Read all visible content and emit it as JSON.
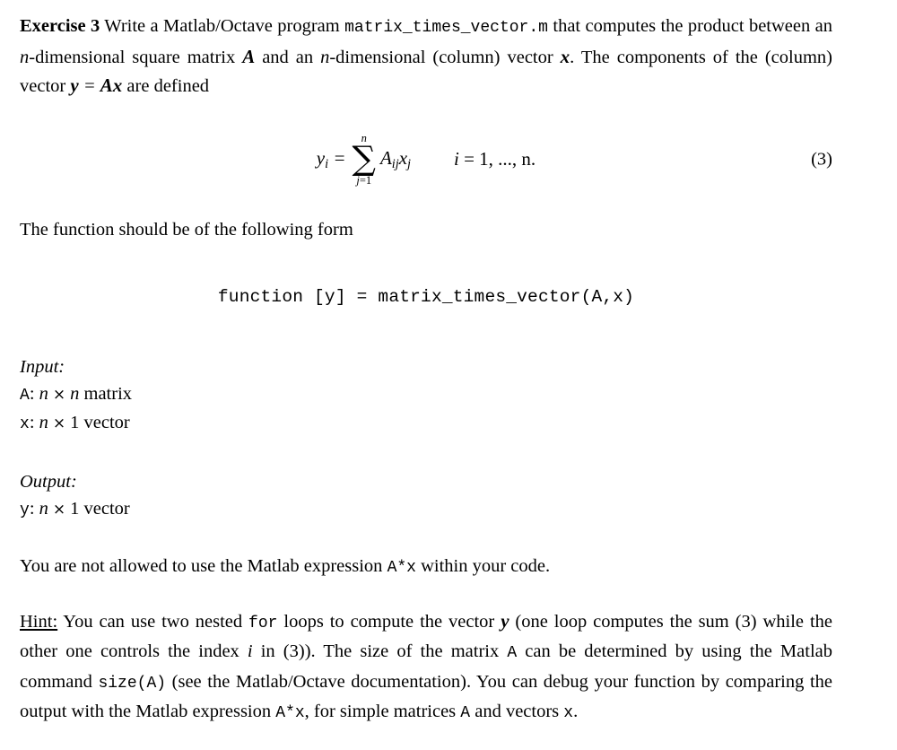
{
  "document": {
    "exercise_label": "Exercise 3",
    "intro": {
      "before_code": " Write a Matlab/Octave program ",
      "code_filename": "matrix_times_vector.m",
      "after_code": " that computes the product between an ",
      "dim_var": "n",
      "mid1": "-dimensional square matrix ",
      "matrix_symbol": "A",
      "mid2": " and an ",
      "dim_var2": "n",
      "mid3": "-dimensional (column) vector ",
      "vector_symbol": "x",
      "mid4": ". The components of the (column) vector ",
      "result_vector": "y",
      "equals": " = ",
      "product": "Ax",
      "tail": " are defined"
    },
    "equation": {
      "lhs_var": "y",
      "lhs_sub": "i",
      "equals": " = ",
      "sum_upper": "n",
      "sum_lower_index": "j",
      "sum_lower_eq": "=1",
      "sum_sign": "∑",
      "summand_A": "A",
      "summand_A_sub": "ij",
      "summand_x": "x",
      "summand_x_sub": "j",
      "condition_var": "i",
      "condition_rest": " = 1, ..., n.",
      "number": "(3)"
    },
    "form_intro": "The function should be of the following form",
    "signature": "function [y] = matrix_times_vector(A,x)",
    "io": {
      "input_heading": "Input:",
      "input_rows": [
        {
          "name": "A",
          "sep": ": ",
          "dim_a": "n",
          "times": "×",
          "dim_b": "n",
          "kind": " matrix"
        },
        {
          "name": "x",
          "sep": ": ",
          "dim_a": "n",
          "times": "×",
          "dim_b": "1",
          "kind": " vector"
        }
      ],
      "output_heading": "Output:",
      "output_rows": [
        {
          "name": "y",
          "sep": ": ",
          "dim_a": "n",
          "times": "×",
          "dim_b": "1",
          "kind": " vector"
        }
      ]
    },
    "restriction": {
      "before": "You are not allowed to use the Matlab expression ",
      "code": "A*x",
      "after": " within your code."
    },
    "hint": {
      "label": "Hint:",
      "p1": " You can use two nested ",
      "code_for": "for",
      "p2": " loops to compute the vector ",
      "vec_y": "y",
      "p3": " (one loop computes the sum (3) while the other one controls the index ",
      "idx_i": "i",
      "p4": " in (3)). The size of the matrix ",
      "code_A": "A",
      "p5": " can be determined by using the Matlab command ",
      "code_size": "size(A)",
      "p6": " (see the Matlab/Octave documentation). You can debug your function by comparing the output with the Matlab expression ",
      "code_Ax": "A*x",
      "p7": ", for simple matrices ",
      "code_A2": "A",
      "p8": " and vectors ",
      "code_x2": "x",
      "p9": "."
    }
  }
}
